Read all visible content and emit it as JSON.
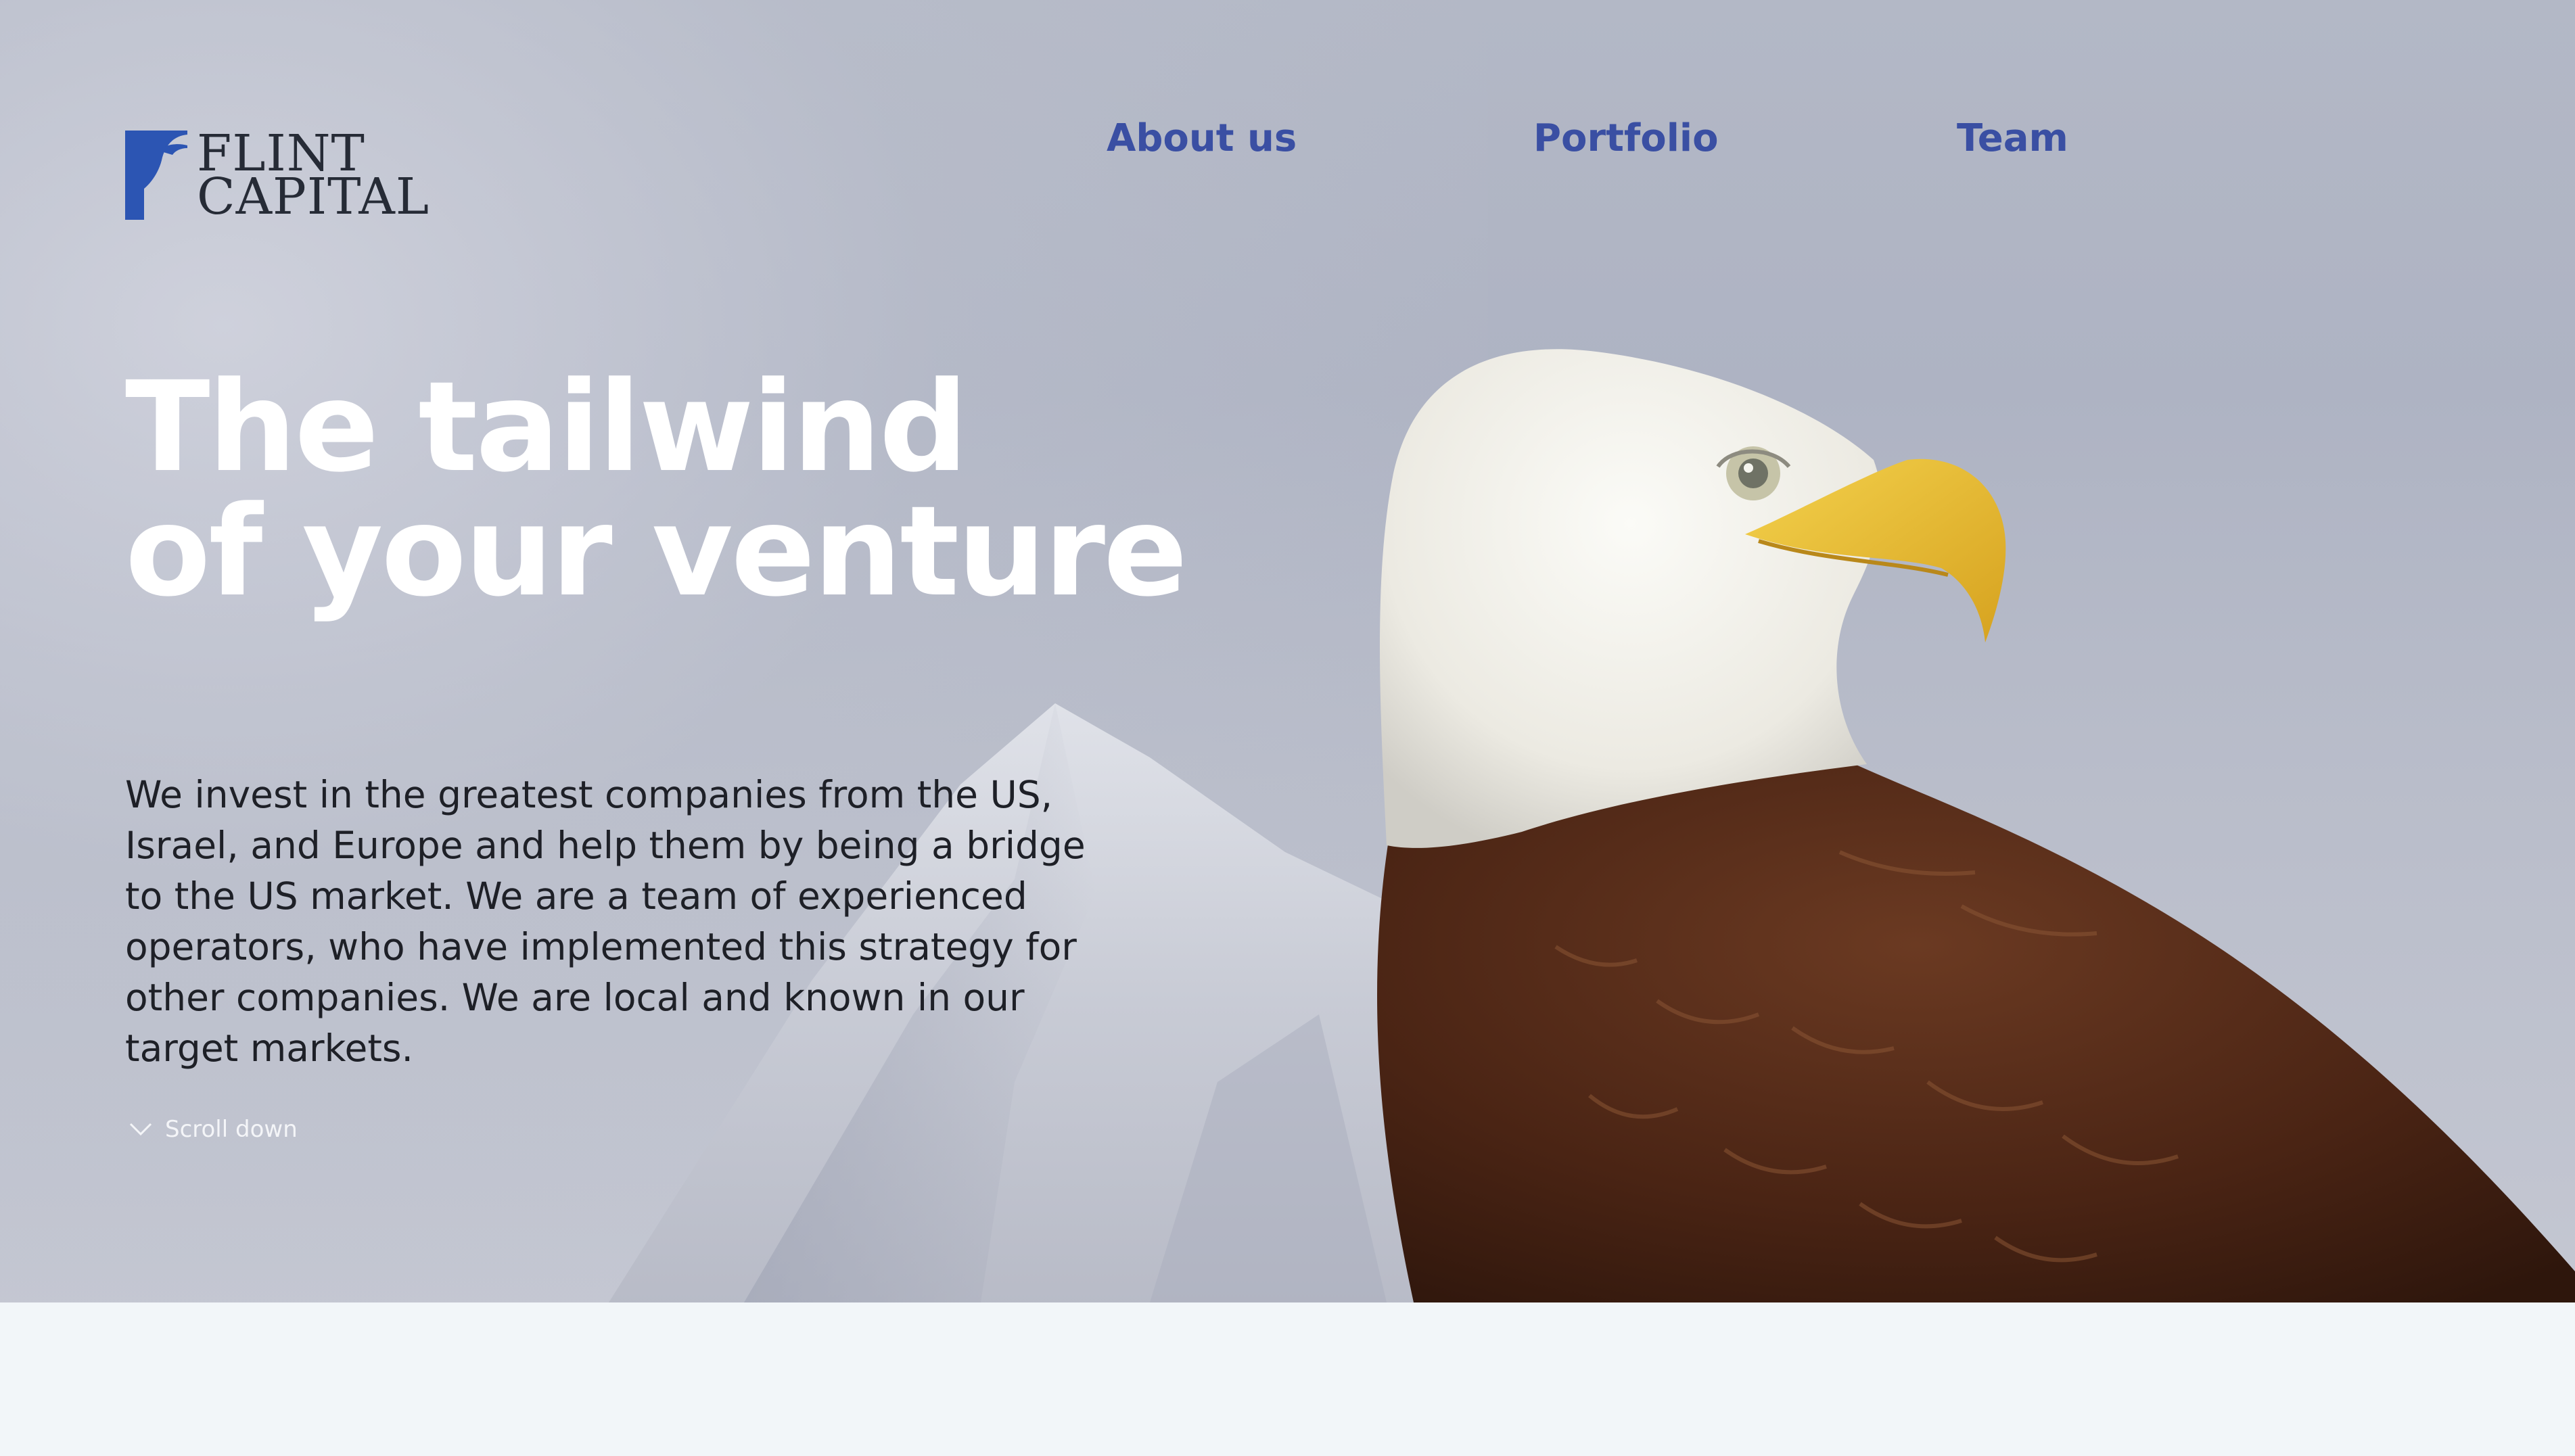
{
  "brand": {
    "line1": "FLINT",
    "line2": "CAPITAL"
  },
  "nav": {
    "about": "About us",
    "portfolio": "Portfolio",
    "team": "Team"
  },
  "hero": {
    "headline_line1": "The tailwind",
    "headline_line2": "of your venture",
    "intro": "We invest in the greatest companies from the US, Israel, and Europe and help them by being a bridge to the US market. We are a team of experienced operators, who have implemented this strategy for other companies. We are local and known in our target markets.",
    "scroll_label": "Scroll down"
  },
  "colors": {
    "nav_accent": "#3a4fa3",
    "logo_mark": "#2c55b3",
    "headline": "#ffffff",
    "body_text": "#1e2027",
    "page_background": "#f2f6f9"
  },
  "icons": {
    "logo_mark": "stylized-eagle-head-mark-icon",
    "scroll": "chevron-down-icon"
  }
}
